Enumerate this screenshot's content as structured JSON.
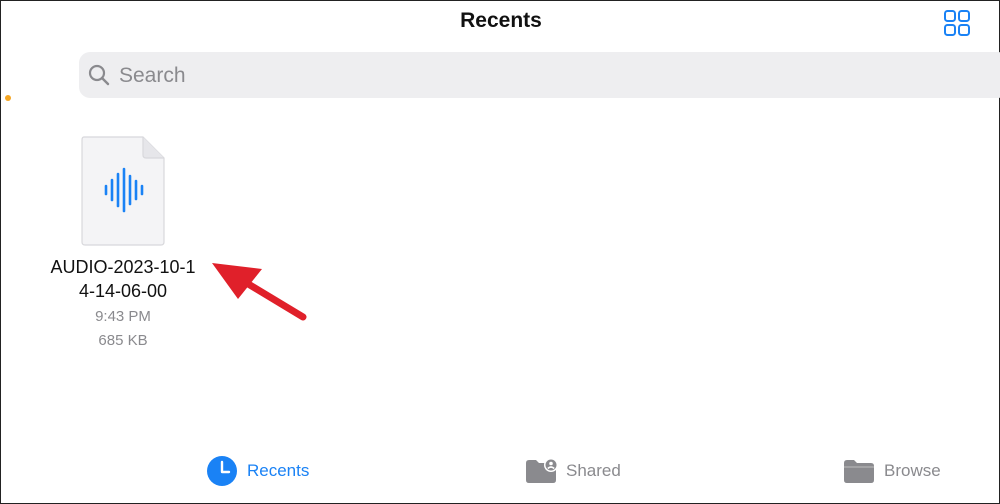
{
  "header": {
    "title": "Recents",
    "view_toggle_icon": "grid-view-icon"
  },
  "search": {
    "placeholder": "Search",
    "value": "",
    "icon": "search-icon"
  },
  "files": [
    {
      "name": "AUDIO-2023-10-14-14-06-00",
      "time": "9:43 PM",
      "size": "685 KB",
      "icon": "audio-waveform-icon"
    }
  ],
  "tab_bar": {
    "tabs": [
      {
        "label": "Recents",
        "icon": "clock-icon",
        "selected": true
      },
      {
        "label": "Shared",
        "icon": "shared-folder-icon",
        "selected": false
      },
      {
        "label": "Browse",
        "icon": "folder-icon",
        "selected": false
      }
    ]
  },
  "colors": {
    "accent": "#1a82f5",
    "secondary_text": "#8a8a8e",
    "search_background": "#eeeef0",
    "annotation_arrow": "#e0202a",
    "status_dot": "#f5a623"
  }
}
